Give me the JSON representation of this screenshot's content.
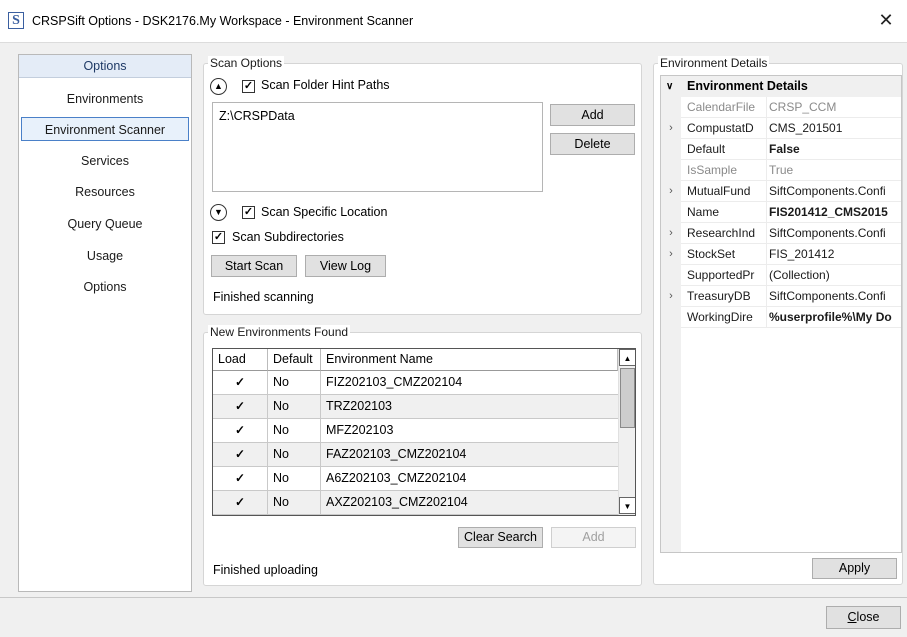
{
  "window": {
    "title": "CRSPSift Options - DSK2176.My Workspace - Environment Scanner",
    "icon_letter": "S",
    "close_glyph": "✕"
  },
  "sidebar": {
    "header": "Options",
    "items": [
      {
        "label": "Environments",
        "selected": false
      },
      {
        "label": "Environment Scanner",
        "selected": true
      },
      {
        "label": "Services",
        "selected": false
      },
      {
        "label": "Resources",
        "selected": false
      },
      {
        "label": "Query Queue",
        "selected": false
      },
      {
        "label": "Usage",
        "selected": false
      },
      {
        "label": "Options",
        "selected": false
      }
    ]
  },
  "scan_options": {
    "title": "Scan Options",
    "folder_hint": {
      "label": "Scan Folder Hint Paths",
      "checked": true,
      "expander": "up"
    },
    "paths": [
      "Z:\\CRSPData"
    ],
    "add_label": "Add",
    "delete_label": "Delete",
    "specific_location": {
      "label": "Scan Specific Location",
      "checked": true,
      "expander": "down"
    },
    "subdirectories": {
      "label": "Scan Subdirectories",
      "checked": true
    },
    "start_scan_label": "Start Scan",
    "view_log_label": "View Log",
    "status": "Finished scanning"
  },
  "new_envs": {
    "title": "New Environments Found",
    "columns": [
      "Load",
      "Default",
      "Environment Name"
    ],
    "rows": [
      {
        "load": true,
        "default": "No",
        "name": "FIZ202103_CMZ202104"
      },
      {
        "load": true,
        "default": "No",
        "name": "TRZ202103"
      },
      {
        "load": true,
        "default": "No",
        "name": "MFZ202103"
      },
      {
        "load": true,
        "default": "No",
        "name": "FAZ202103_CMZ202104"
      },
      {
        "load": true,
        "default": "No",
        "name": "A6Z202103_CMZ202104"
      },
      {
        "load": true,
        "default": "No",
        "name": "AXZ202103_CMZ202104"
      }
    ],
    "clear_search_label": "Clear Search",
    "add_label": "Add",
    "status": "Finished uploading"
  },
  "env_details": {
    "title": "Environment Details",
    "section": "Environment Details",
    "properties": [
      {
        "name": "CalendarFile",
        "value": "CRSP_CCM",
        "expandable": false,
        "bold": false,
        "disabled": true
      },
      {
        "name": "CompustatD",
        "value": "CMS_201501",
        "expandable": true,
        "bold": false,
        "disabled": false
      },
      {
        "name": "Default",
        "value": "False",
        "expandable": false,
        "bold": true,
        "disabled": false
      },
      {
        "name": "IsSample",
        "value": "True",
        "expandable": false,
        "bold": false,
        "disabled": true
      },
      {
        "name": "MutualFund",
        "value": "SiftComponents.Confi",
        "expandable": true,
        "bold": false,
        "disabled": false
      },
      {
        "name": "Name",
        "value": "FIS201412_CMS2015",
        "expandable": false,
        "bold": true,
        "disabled": false
      },
      {
        "name": "ResearchInd",
        "value": "SiftComponents.Confi",
        "expandable": true,
        "bold": false,
        "disabled": false
      },
      {
        "name": "StockSet",
        "value": "FIS_201412",
        "expandable": true,
        "bold": false,
        "disabled": false
      },
      {
        "name": "SupportedPr",
        "value": "(Collection)",
        "expandable": false,
        "bold": false,
        "disabled": false
      },
      {
        "name": "TreasuryDB",
        "value": "SiftComponents.Confi",
        "expandable": true,
        "bold": false,
        "disabled": false
      },
      {
        "name": "WorkingDire",
        "value": "%userprofile%\\My Do",
        "expandable": false,
        "bold": true,
        "disabled": false
      }
    ],
    "apply_label": "Apply"
  },
  "footer": {
    "close_label": "Close"
  },
  "icons": {
    "expander_up": "chevron-up-icon",
    "expander_down": "chevron-down-icon",
    "checkbox": "checkmark-icon",
    "row_expand": "chevron-right-icon",
    "section_collapse": "chevron-down-icon"
  },
  "colors": {
    "selection_border": "#4a80c8",
    "header_bg": "#e4ecf7"
  }
}
